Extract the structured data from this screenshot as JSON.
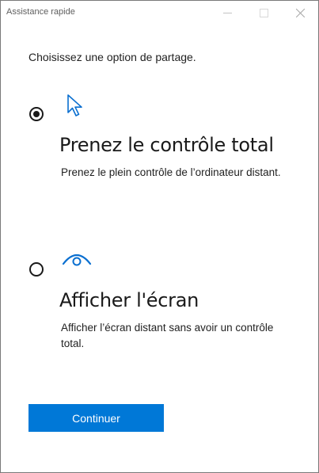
{
  "window": {
    "title": "Assistance rapide"
  },
  "prompt": "Choisissez une option de partage.",
  "options": [
    {
      "icon": "cursor-icon",
      "selected": true,
      "title": "Prenez le contrôle total",
      "description": "Prenez le plein contrôle de l’ordinateur distant."
    },
    {
      "icon": "eye-icon",
      "selected": false,
      "title": "Afficher l'écran",
      "description": "Afficher l’écran distant sans avoir un contrôle total."
    }
  ],
  "continue_label": "Continuer",
  "colors": {
    "accent": "#0078d7",
    "text": "#1a1a1a",
    "window_controls": "#c4c4c4"
  }
}
